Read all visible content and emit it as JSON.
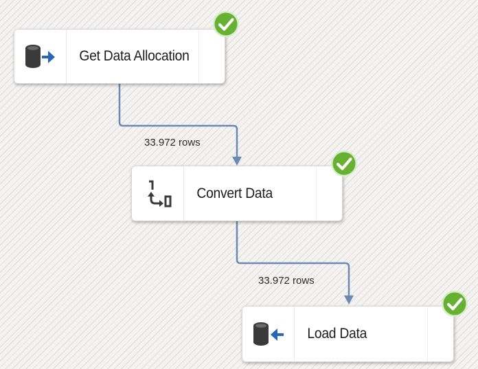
{
  "tasks": [
    {
      "id": "get-data-allocation",
      "label": "Get Data Allocation",
      "icon": "source-database-icon",
      "status": "success"
    },
    {
      "id": "convert-data",
      "label": "Convert Data",
      "icon": "data-conversion-icon",
      "status": "success"
    },
    {
      "id": "load-data",
      "label": "Load Data",
      "icon": "destination-database-icon",
      "status": "success"
    }
  ],
  "paths": [
    {
      "from": "get-data-allocation",
      "to": "convert-data",
      "rows_label": "33.972 rows"
    },
    {
      "from": "convert-data",
      "to": "load-data",
      "rows_label": "33.972 rows"
    }
  ],
  "colors": {
    "connector": "#6a8ab3",
    "check_fill": "#66b132",
    "arrow_blue": "#2867b6",
    "cylinder": "#3a3a3a"
  }
}
